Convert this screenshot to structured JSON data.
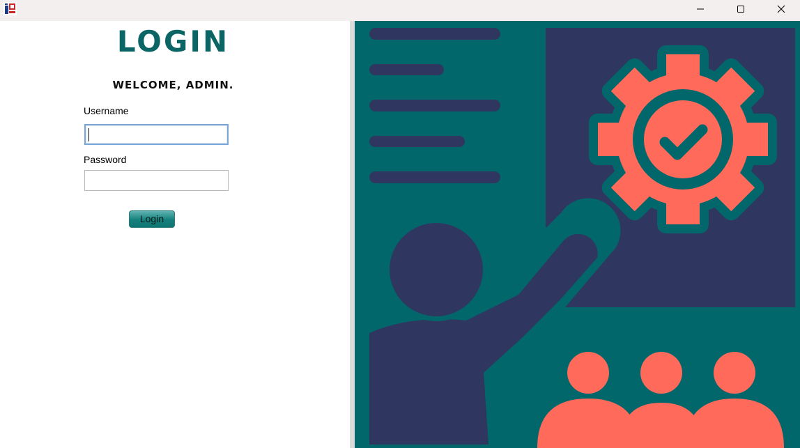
{
  "window": {
    "app_icon": "app-logo-icon",
    "controls": {
      "minimize_icon": "minimize-icon",
      "maximize_icon": "maximize-icon",
      "close_icon": "close-icon"
    }
  },
  "login": {
    "title": "LOGIN",
    "welcome": "WELCOME, ADMIN.",
    "username_label": "Username",
    "username_value": "",
    "password_label": "Password",
    "password_value": "",
    "button_label": "Login"
  },
  "illustration": {
    "name": "presenter-with-gear-illustration",
    "colors": {
      "background": "#02676a",
      "board": "#2f3761",
      "accent": "#ff6a5a"
    }
  }
}
